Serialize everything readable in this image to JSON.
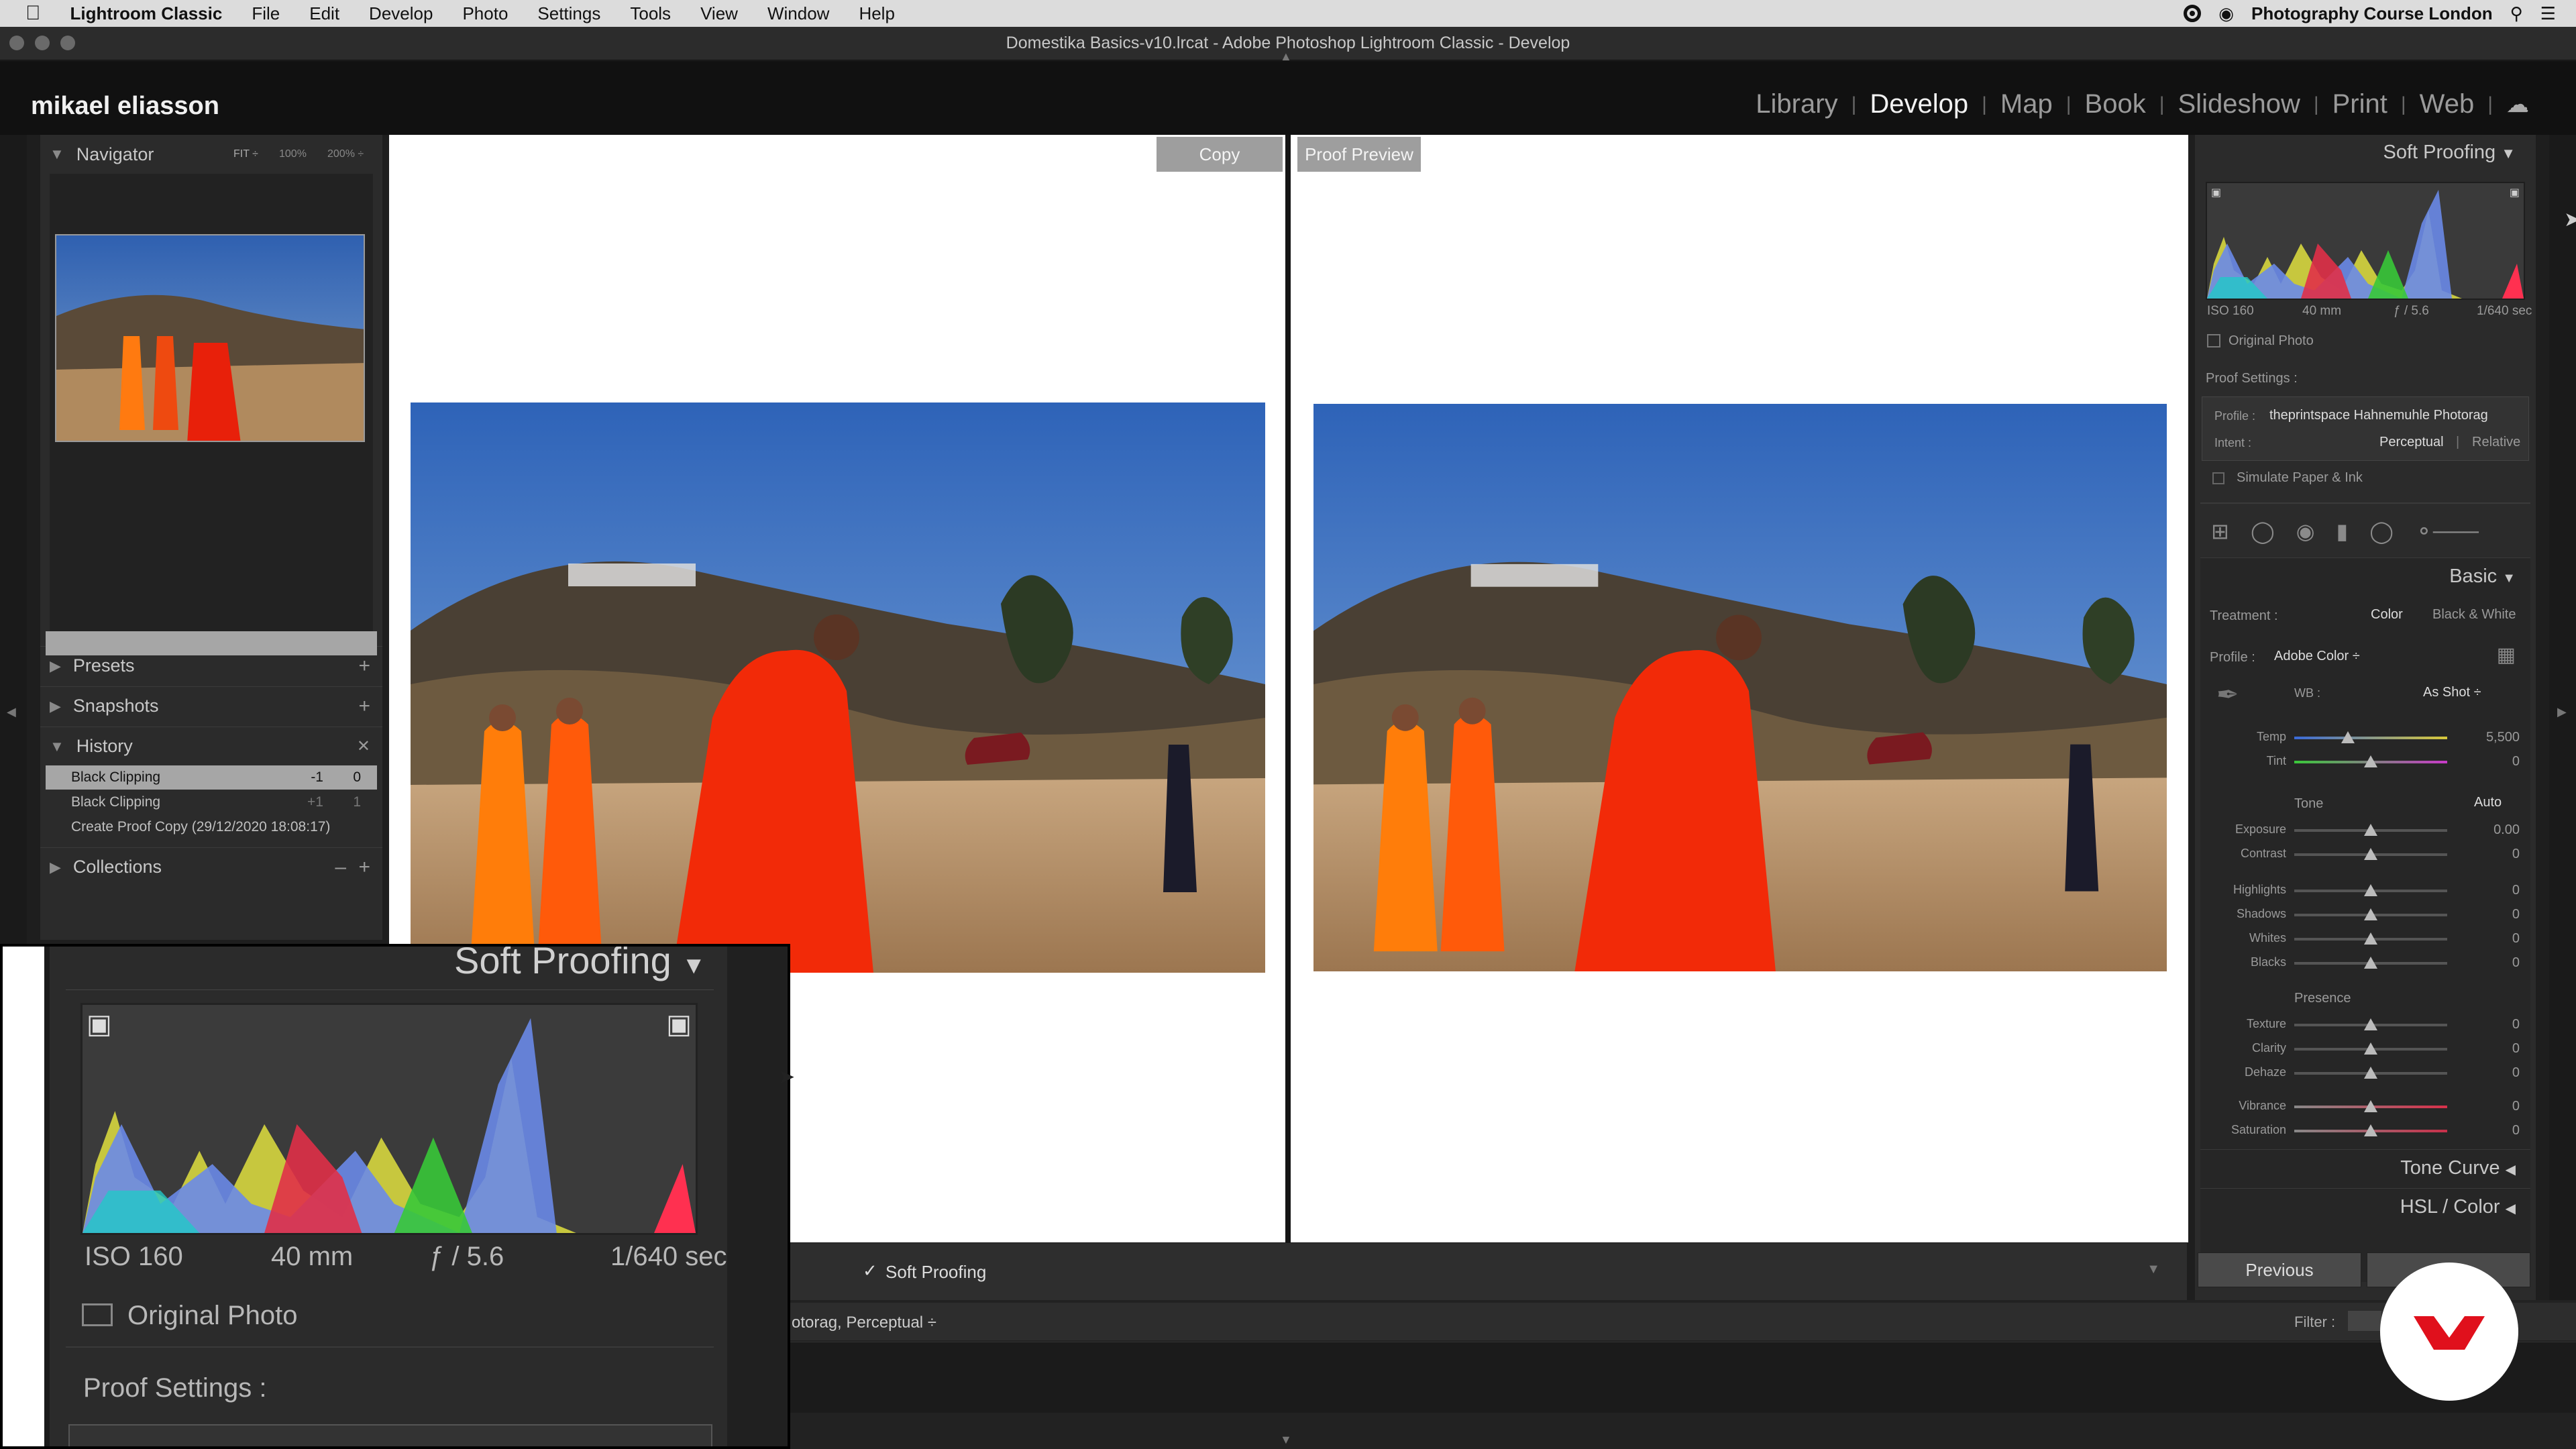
{
  "menubar": {
    "app": "Lightroom Classic",
    "items": [
      "File",
      "Edit",
      "Develop",
      "Photo",
      "Settings",
      "Tools",
      "View",
      "Window",
      "Help"
    ],
    "right_text": "Photography Course London"
  },
  "window": {
    "title": "Domestika Basics-v10.lrcat - Adobe Photoshop Lightroom Classic - Develop"
  },
  "identity": {
    "name": "mikael eliasson"
  },
  "modules": [
    "Library",
    "Develop",
    "Map",
    "Book",
    "Slideshow",
    "Print",
    "Web"
  ],
  "active_module": "Develop",
  "left_panel": {
    "navigator": {
      "title": "Navigator",
      "zoom": [
        "FIT ÷",
        "100%",
        "200% ÷"
      ]
    },
    "presets": "Presets",
    "snapshots": "Snapshots",
    "history": {
      "title": "History",
      "rows": [
        {
          "label": "Black Clipping",
          "v1": "-1",
          "v2": "0"
        },
        {
          "label": "Black Clipping",
          "v1": "+1",
          "v2": "1"
        },
        {
          "label": "Create Proof Copy (29/12/2020 18:08:17)",
          "v1": "",
          "v2": ""
        }
      ]
    },
    "collections": "Collections"
  },
  "canvas": {
    "left_tag": "Copy",
    "right_tag": "Proof Preview"
  },
  "toolbar": {
    "soft_proofing": "Soft Proofing",
    "proof_info": "otorag, Perceptual ÷"
  },
  "right_panel": {
    "soft_proofing_title": "Soft Proofing",
    "exif": {
      "iso": "ISO 160",
      "focal": "40 mm",
      "aperture": "ƒ / 5.6",
      "shutter": "1/640 sec"
    },
    "original_photo": "Original Photo",
    "proof_settings": "Proof Settings :",
    "profile_label": "Profile :",
    "profile_value": "theprintspace Hahnemuhle Photorag",
    "intent_label": "Intent :",
    "intent_options": [
      "Perceptual",
      "Relative"
    ],
    "simulate": "Simulate Paper & Ink",
    "basic": {
      "title": "Basic",
      "treatment_label": "Treatment :",
      "treatment_options": [
        "Color",
        "Black & White"
      ],
      "profile_label": "Profile :",
      "profile_value": "Adobe Color ÷",
      "wb_label": "WB :",
      "wb_value": "As Shot ÷",
      "tone_label": "Tone",
      "auto": "Auto",
      "presence_label": "Presence",
      "sliders": [
        {
          "label": "Temp",
          "value": "5,500",
          "pos": 0.35
        },
        {
          "label": "Tint",
          "value": "0",
          "pos": 0.5
        },
        {
          "label": "Exposure",
          "value": "0.00",
          "pos": 0.5
        },
        {
          "label": "Contrast",
          "value": "0",
          "pos": 0.5
        },
        {
          "label": "Highlights",
          "value": "0",
          "pos": 0.5
        },
        {
          "label": "Shadows",
          "value": "0",
          "pos": 0.5
        },
        {
          "label": "Whites",
          "value": "0",
          "pos": 0.5
        },
        {
          "label": "Blacks",
          "value": "0",
          "pos": 0.5
        },
        {
          "label": "Texture",
          "value": "0",
          "pos": 0.5
        },
        {
          "label": "Clarity",
          "value": "0",
          "pos": 0.5
        },
        {
          "label": "Dehaze",
          "value": "0",
          "pos": 0.5
        },
        {
          "label": "Vibrance",
          "value": "0",
          "pos": 0.5
        },
        {
          "label": "Saturation",
          "value": "0",
          "pos": 0.5
        }
      ]
    },
    "tone_curve": "Tone Curve",
    "hsl": "HSL / Color",
    "previous": "Previous"
  },
  "filmstrip": {
    "filter": "Filter :"
  },
  "zoom_inset": {
    "title": "Soft Proofing",
    "iso": "ISO 160",
    "focal": "40 mm",
    "aperture": "ƒ / 5.6",
    "shutter": "1/640 sec",
    "original_photo": "Original Photo",
    "proof_settings": "Proof Settings :"
  },
  "colors": {
    "accent": "#c8c8c8",
    "bg": "#1e1e1e",
    "panel": "#2b2b2b"
  }
}
